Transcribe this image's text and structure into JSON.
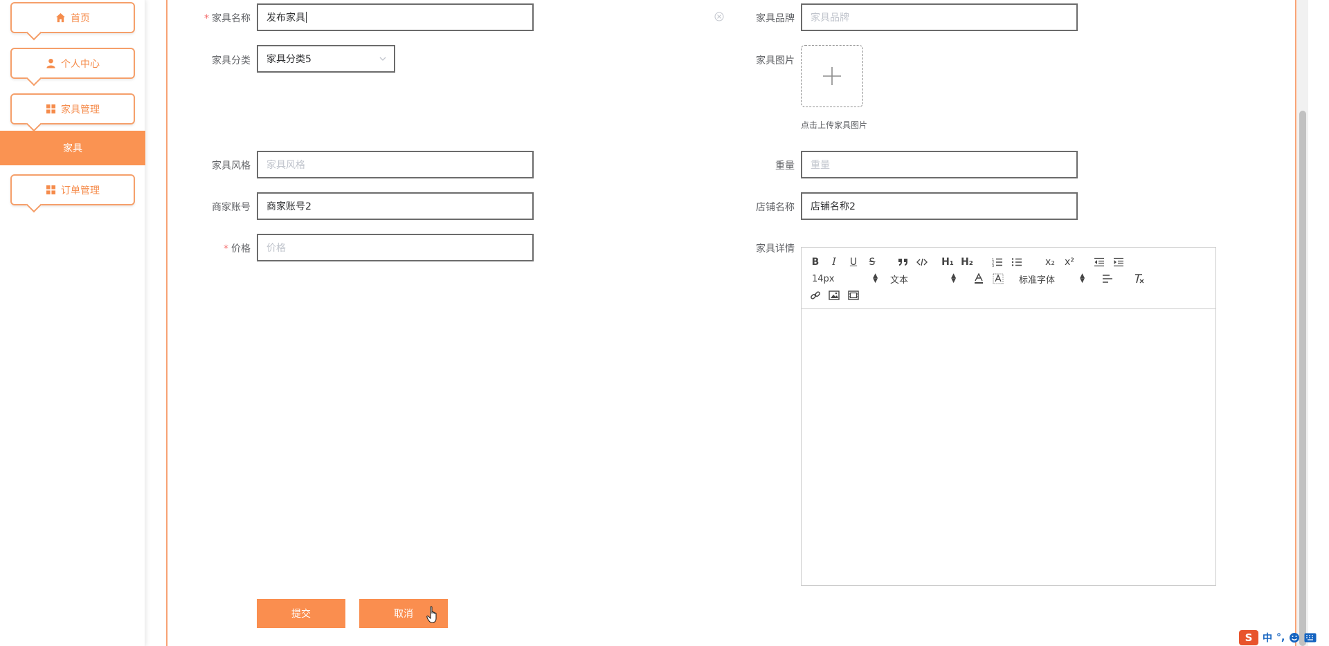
{
  "sidebar": {
    "items": [
      {
        "label": "首页",
        "icon": "home-icon"
      },
      {
        "label": "个人中心",
        "icon": "user-icon"
      },
      {
        "label": "家具管理",
        "icon": "grid-icon"
      },
      {
        "label": "订单管理",
        "icon": "grid-icon"
      }
    ],
    "active_subitem": "家具"
  },
  "form": {
    "name": {
      "label": "家具名称",
      "required": true,
      "value": "发布家具"
    },
    "brand": {
      "label": "家具品牌",
      "placeholder": "家具品牌"
    },
    "category": {
      "label": "家具分类",
      "value": "家具分类5"
    },
    "image": {
      "label": "家具图片",
      "tip": "点击上传家具图片"
    },
    "style": {
      "label": "家具风格",
      "placeholder": "家具风格"
    },
    "weight": {
      "label": "重量",
      "placeholder": "重量"
    },
    "merchant_account": {
      "label": "商家账号",
      "value": "商家账号2"
    },
    "shop_name": {
      "label": "店铺名称",
      "value": "店铺名称2"
    },
    "price": {
      "label": "价格",
      "required": true,
      "placeholder": "价格"
    },
    "details": {
      "label": "家具详情"
    }
  },
  "editor": {
    "toolbar": {
      "row1": [
        "B",
        "I",
        "U",
        "S",
        "quote",
        "code",
        "H1",
        "H2",
        "ordered-list",
        "bullet-list",
        "subscript",
        "superscript",
        "outdent",
        "indent"
      ],
      "size_select": "14px",
      "header_select": "文本",
      "font_select": "标准字体",
      "h1": "H₁",
      "h2": "H₂",
      "sub": "x₂",
      "sup": "x²"
    }
  },
  "buttons": {
    "submit": "提交",
    "cancel": "取消"
  },
  "ime": {
    "logo": "S",
    "text": "中"
  },
  "colors": {
    "accent": "#fa8e4f",
    "menu_border": "#f59f6a",
    "required": "#f56c6c"
  }
}
